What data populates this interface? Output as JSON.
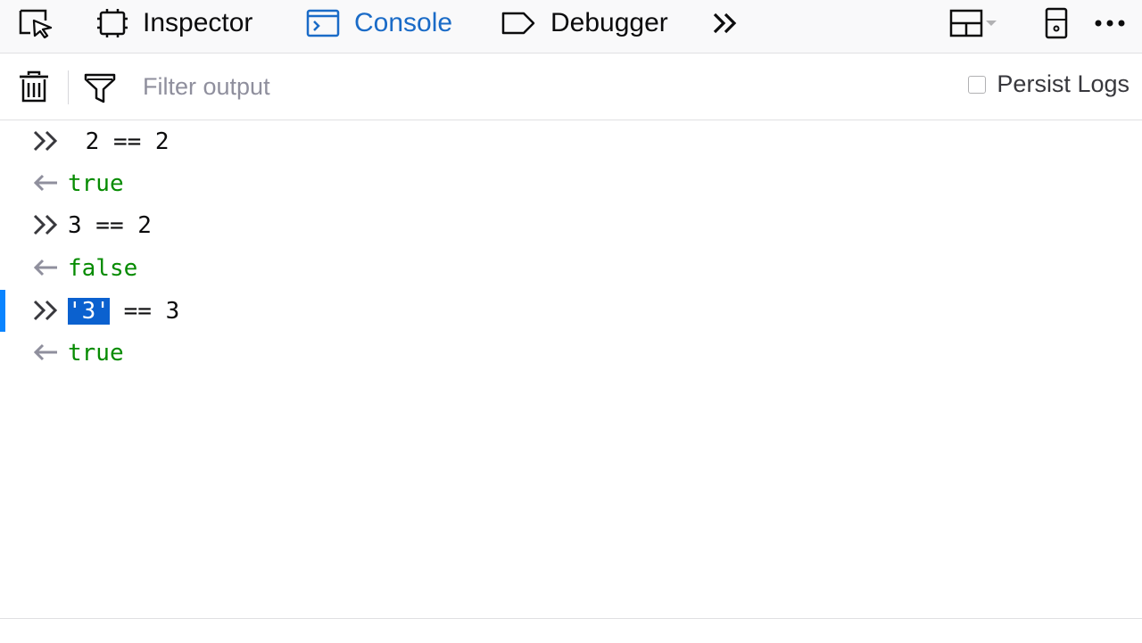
{
  "toolbar": {
    "tabs": [
      {
        "label": "Inspector",
        "icon": "inspector-icon"
      },
      {
        "label": "Console",
        "icon": "console-icon",
        "selected": true
      },
      {
        "label": "Debugger",
        "icon": "debugger-icon"
      }
    ],
    "accent_color": "#0a84ff"
  },
  "filterbar": {
    "filter_placeholder": "Filter output",
    "persist_logs_label": "Persist Logs",
    "persist_logs_checked": false
  },
  "console": {
    "entries": [
      {
        "type": "input",
        "text": " 2 == 2"
      },
      {
        "type": "result",
        "text": "true"
      },
      {
        "type": "input",
        "text": "3 == 2"
      },
      {
        "type": "result",
        "text": "false"
      },
      {
        "type": "input",
        "selected_part": "'3'",
        "rest": " == 3"
      },
      {
        "type": "result",
        "text": "true"
      }
    ]
  }
}
